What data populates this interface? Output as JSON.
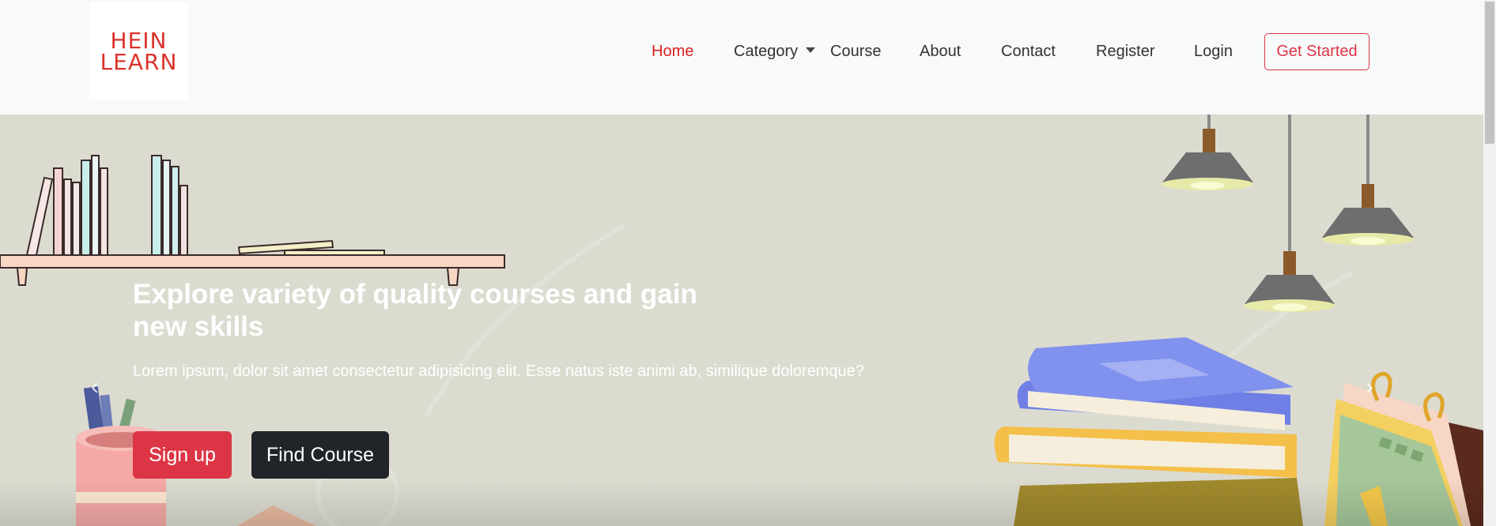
{
  "brand": {
    "line1": "HEIN",
    "line2": "LEARN",
    "color": "#d9342b"
  },
  "nav": {
    "items": [
      {
        "label": "Home",
        "active": true
      },
      {
        "label": "Category",
        "dropdown": true
      },
      {
        "label": "Course"
      },
      {
        "label": "About"
      },
      {
        "label": "Contact"
      },
      {
        "label": "Register"
      },
      {
        "label": "Login"
      }
    ],
    "cta_label": "Get Started"
  },
  "hero": {
    "title": "Explore variety of quality courses and gain new skills",
    "text": "Lorem ipsum, dolor sit amet consectetur adipisicing elit. Esse natus iste animi ab, similique doloremque?",
    "signup_label": "Sign up",
    "find_label": "Find Course",
    "prev_icon": "chevron-left-icon",
    "next_icon": "chevron-right-icon"
  },
  "colors": {
    "accent": "#dc3545",
    "active_link": "#dc1f1f",
    "dark_button": "#212529",
    "hero_bg": "#dcdbd0"
  }
}
